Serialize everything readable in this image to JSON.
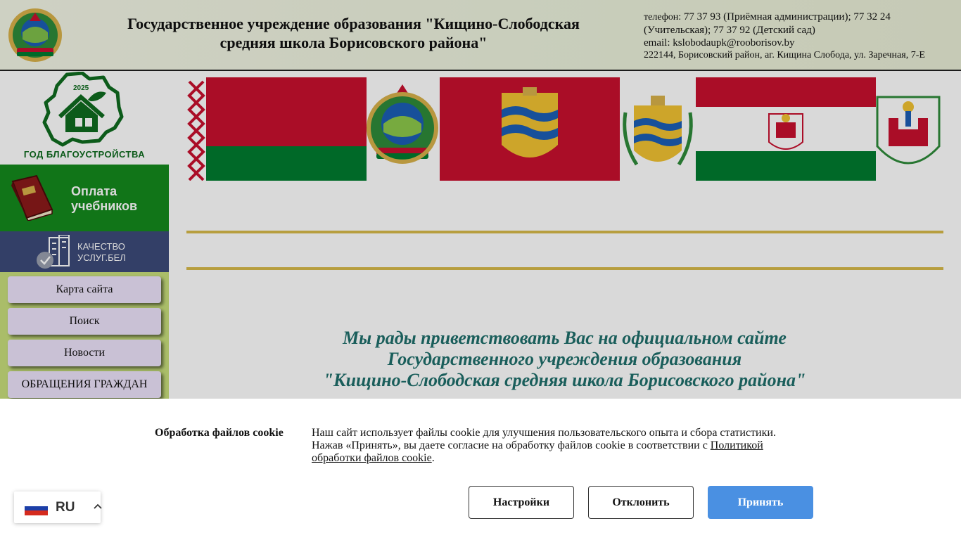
{
  "header": {
    "title": "Государственное учреждение образования \"Кищино-Слободская средняя школа Борисовского района\"",
    "phone_label": "телефон:",
    "phones": "77 37 93 (Приёмная администрации); 77 32 24 (Учительская); 77 37 92 (Детский сад)",
    "email": "email: kslobodaupk@rooborisov.by",
    "address": "222144, Борисовский район, аг. Кищина Слобода, ул. Заречная, 7-Е"
  },
  "sidebar": {
    "year_logo": {
      "year": "2025",
      "caption": "ГОД БЛАГОУСТРОЙСТВА"
    },
    "pay_banner": {
      "line1": "Оплата",
      "line2": "учебников"
    },
    "quality": {
      "line1": "КАЧЕСТВО",
      "line2": "УСЛУГ.БЕЛ"
    },
    "nav": [
      {
        "label": "Карта сайта"
      },
      {
        "label": "Поиск"
      },
      {
        "label": "Новости"
      },
      {
        "label": "ОБРАЩЕНИЯ ГРАЖДАН"
      }
    ]
  },
  "main": {
    "welcome": {
      "line1": "Мы рады приветствовать Вас на официальном сайте",
      "line2": "Государственного учреждения образования",
      "line3": "\"Кищино-Слободская средняя школа Борисовского района\""
    }
  },
  "cookie": {
    "title": "Обработка файлов cookie",
    "text_line1": "Наш сайт использует файлы cookie для улучшения пользовательского опыта и сбора статистики.",
    "text_line2": "Нажав «Принять», вы даете согласие на обработку файлов cookie в соответствии с ",
    "policy_link": "Политикой обработки файлов cookie",
    "period": ".",
    "buttons": {
      "settings": "Настройки",
      "decline": "Отклонить",
      "accept": "Принять"
    }
  },
  "language": {
    "code": "RU"
  },
  "colors": {
    "flag_red": "#c8102e",
    "flag_green": "#007c30",
    "sidebar_bg": "#c8df7c",
    "pay_green": "#158a1d",
    "quality_blue": "#3d4a7a",
    "welcome_teal": "#1f6f6b",
    "accept_blue": "#4a90e2",
    "rule_gold": "#d8ba4a"
  }
}
